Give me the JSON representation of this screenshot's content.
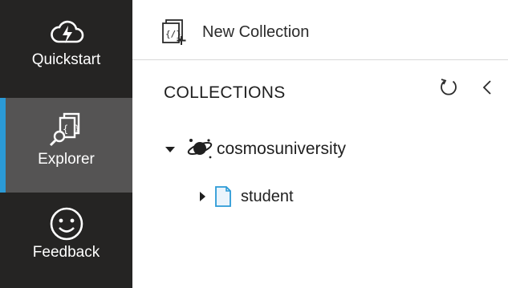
{
  "sidebar": {
    "items": [
      {
        "label": "Quickstart",
        "icon": "cloud-lightning-icon"
      },
      {
        "label": "Explorer",
        "icon": "document-search-icon",
        "active": true
      },
      {
        "label": "Feedback",
        "icon": "smiley-icon"
      }
    ]
  },
  "commandbar": {
    "new_collection_label": "New Collection",
    "new_collection_icon": "new-collection-icon"
  },
  "pane": {
    "title": "COLLECTIONS",
    "refresh_icon": "refresh-icon",
    "collapse_icon": "chevron-left-icon"
  },
  "tree": {
    "database": {
      "label": "cosmosuniversity",
      "icon": "database-planet-icon",
      "expanded": true
    },
    "collection": {
      "label": "student",
      "icon": "collection-icon",
      "expanded": false
    }
  },
  "colors": {
    "sidebar_bg": "#252423",
    "active_item_bg": "#555454",
    "active_indicator": "#2b9ad6",
    "accent": "#2b9ad6"
  }
}
